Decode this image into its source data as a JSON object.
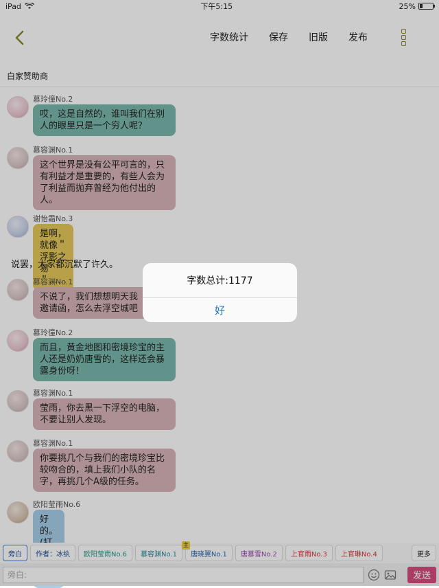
{
  "status": {
    "device": "iPad",
    "time": "下午5:15",
    "battery": "25%",
    "battery_level": 0.25
  },
  "nav": {
    "actions": [
      "字数统计",
      "保存",
      "旧版",
      "发布"
    ]
  },
  "sponsor_label": "白家赞助商",
  "messages": [
    {
      "sender": "慕玲僮No.2",
      "text": [
        "哎，这是自然的，谁叫我们在别",
        "人的眼里只是一个穷人呢？"
      ]
    },
    {
      "sender": "慕容渊No.1",
      "text": [
        "这个世界是没有公平可言的，只",
        "有利益才是重要的，有些人会为",
        "了利益而抛弃曾经为他付出的",
        "人。"
      ]
    },
    {
      "sender": "谢怡霜No.3",
      "text": [
        "是啊，就像＂浮影之易＂……"
      ]
    },
    {
      "narration": "说罢，大家都沉默了许久。"
    },
    {
      "sender": "慕容渊No.1",
      "text": [
        "不说了，我们想想明天我",
        "邀请函，怎么去浮空城吧"
      ]
    },
    {
      "sender": "慕玲僮No.2",
      "text": [
        "而且，黄金地图和密境珍宝的主",
        "人还是奶奶唐雪的，这样还会暴",
        "露身份呀！"
      ]
    },
    {
      "sender": "慕容渊No.1",
      "text": [
        "莹雨，你去黑一下浮空的电脑，",
        "不要让别人发现。"
      ]
    },
    {
      "sender": "慕容渊No.1",
      "text": [
        "你要挑几个与我们的密境珍宝比",
        "较吻合的，填上我们小队的名",
        "字，再挑几个A级的任务。"
      ]
    },
    {
      "sender": "欧阳莹雨No.6",
      "text": [
        "好的。(打开了电脑)"
      ]
    }
  ],
  "toolbar": {
    "chips": [
      "旁白",
      "作者：冰纨",
      "欧阳莹雨No.6",
      "慕容渊No.1",
      "唐晓翼No.1",
      "唐慕雪No.2",
      "上官雨No.3",
      "上官琳No.4"
    ],
    "badge": "主",
    "more": "更多"
  },
  "input": {
    "placeholder": "旁白:",
    "send": "发送"
  },
  "alert": {
    "message": "字数总计:1177",
    "button": "好"
  },
  "colors": {
    "accent_send": "#d64c7f",
    "alert_button": "#1e70c8",
    "bubble_teal": "#7ab8ad",
    "bubble_pink": "#d7b5b9",
    "bubble_yellow": "#e6c95a",
    "bubble_blue": "#a8cfe9"
  }
}
